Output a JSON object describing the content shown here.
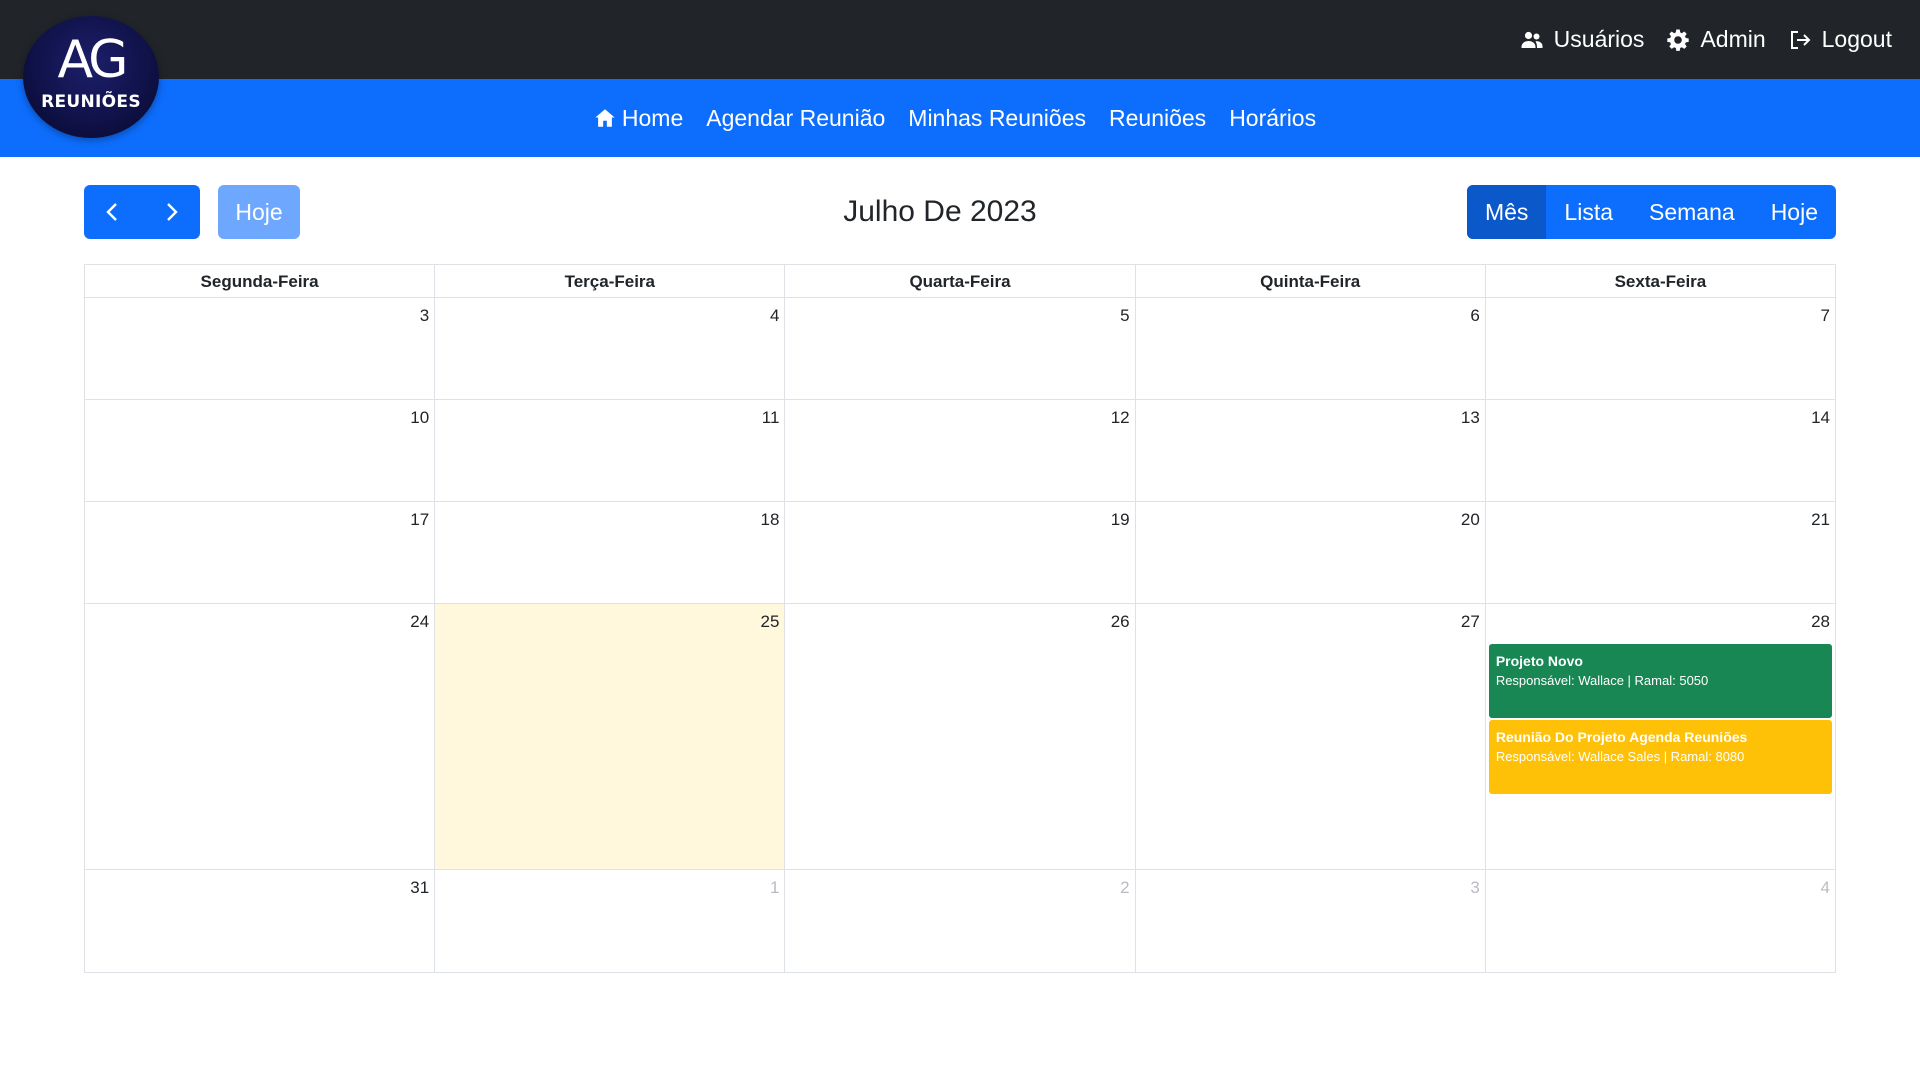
{
  "topbar": {
    "links": [
      {
        "label": "Usuários",
        "icon": "users-icon"
      },
      {
        "label": "Admin",
        "icon": "gear-icon"
      },
      {
        "label": "Logout",
        "icon": "logout-icon"
      }
    ]
  },
  "logo": {
    "mark": "AG",
    "text": "REUNIÕES"
  },
  "nav": {
    "links": [
      {
        "label": "Home",
        "icon": "home-icon"
      },
      {
        "label": "Agendar Reunião"
      },
      {
        "label": "Minhas Reuniões"
      },
      {
        "label": "Reuniões"
      },
      {
        "label": "Horários"
      }
    ]
  },
  "toolbar": {
    "prev_icon": "chevron-left-icon",
    "next_icon": "chevron-right-icon",
    "today_label": "Hoje",
    "title": "Julho De 2023",
    "views": [
      {
        "label": "Mês",
        "active": true
      },
      {
        "label": "Lista",
        "active": false
      },
      {
        "label": "Semana",
        "active": false
      },
      {
        "label": "Hoje",
        "active": false
      }
    ]
  },
  "calendar": {
    "weekdays": [
      "Segunda-Feira",
      "Terça-Feira",
      "Quarta-Feira",
      "Quinta-Feira",
      "Sexta-Feira"
    ],
    "weeks": [
      {
        "days": [
          {
            "n": "3"
          },
          {
            "n": "4"
          },
          {
            "n": "5"
          },
          {
            "n": "6"
          },
          {
            "n": "7"
          }
        ]
      },
      {
        "days": [
          {
            "n": "10"
          },
          {
            "n": "11"
          },
          {
            "n": "12"
          },
          {
            "n": "13"
          },
          {
            "n": "14"
          }
        ]
      },
      {
        "days": [
          {
            "n": "17"
          },
          {
            "n": "18"
          },
          {
            "n": "19"
          },
          {
            "n": "20"
          },
          {
            "n": "21"
          }
        ]
      },
      {
        "days": [
          {
            "n": "24"
          },
          {
            "n": "25",
            "today": true
          },
          {
            "n": "26"
          },
          {
            "n": "27"
          },
          {
            "n": "28"
          }
        ]
      },
      {
        "days": [
          {
            "n": "31"
          },
          {
            "n": "1",
            "other": true
          },
          {
            "n": "2",
            "other": true
          },
          {
            "n": "3",
            "other": true
          },
          {
            "n": "4",
            "other": true
          }
        ]
      }
    ],
    "events": [
      {
        "title": "Projeto Novo",
        "subtitle": "Responsável: Wallace | Ramal: 5050",
        "color": "#198754"
      },
      {
        "title": "Reunião Do Projeto Agenda Reuniões",
        "subtitle": "Responsável: Wallace Sales | Ramal: 8080",
        "color": "#ffc107"
      }
    ]
  },
  "colors": {
    "topbar": "#212529",
    "navbar": "#0d6efd",
    "today_bg": "#fff8dd"
  }
}
